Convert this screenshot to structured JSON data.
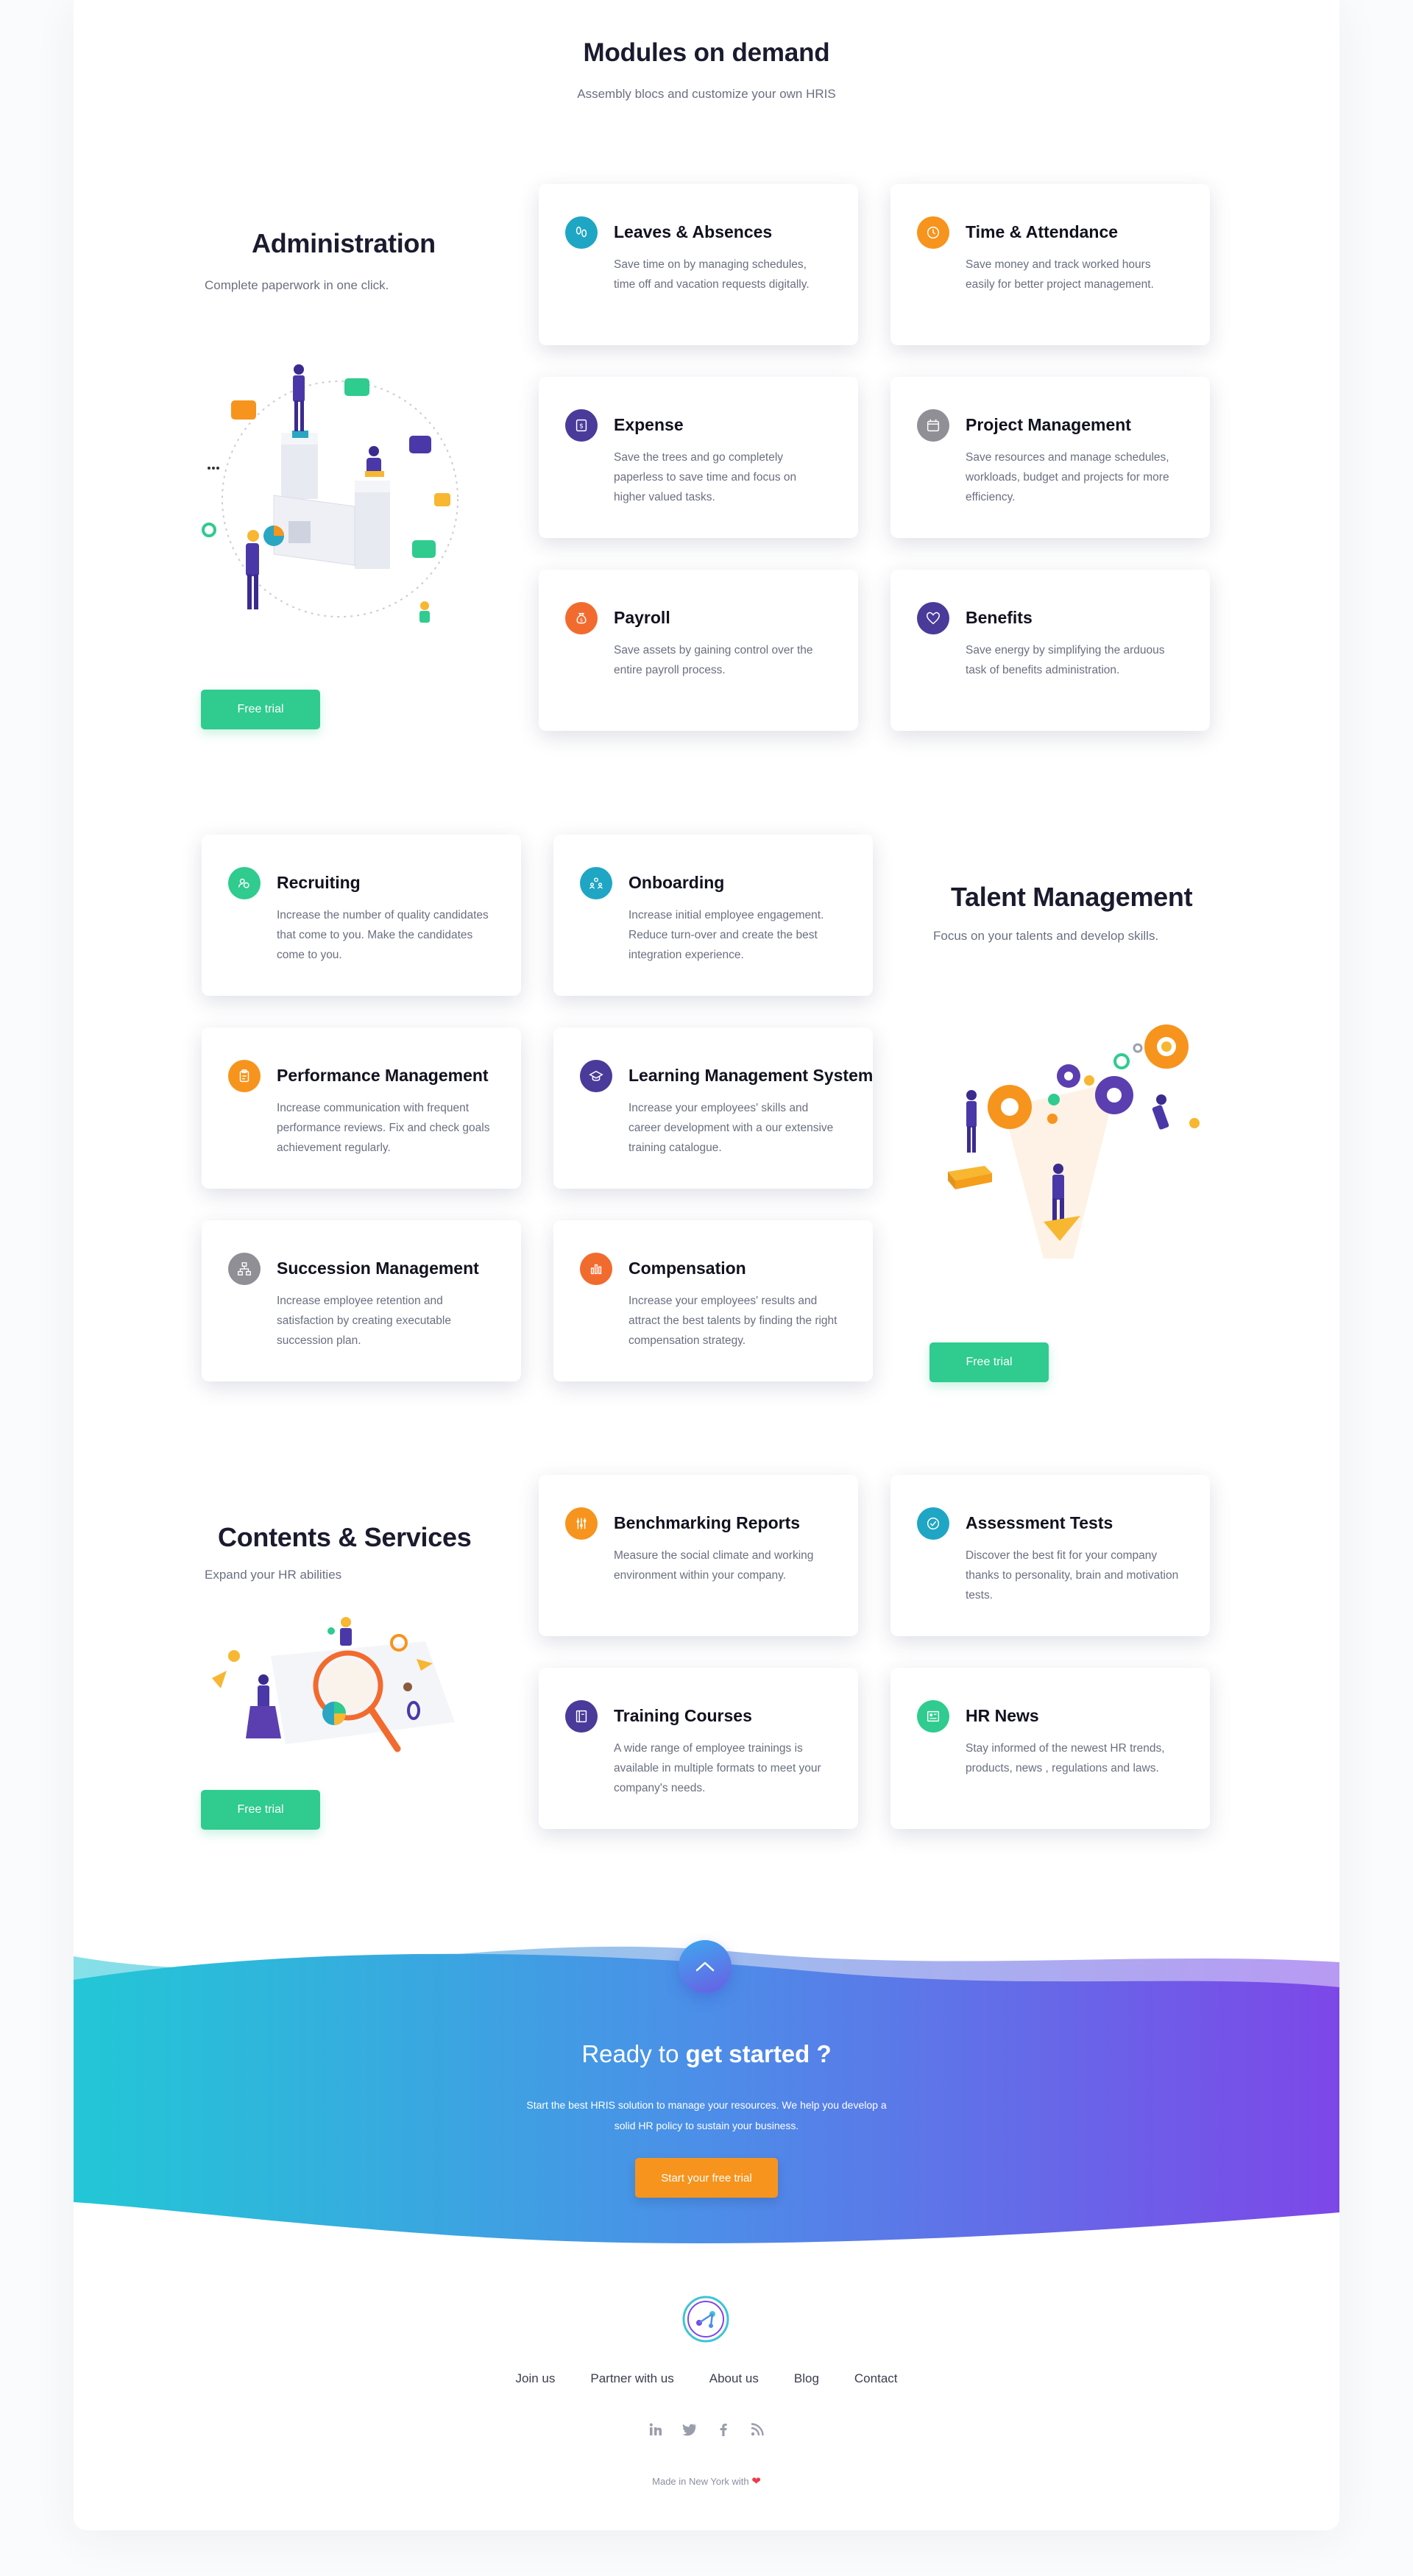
{
  "header": {
    "title": "Modules on demand",
    "subtitle": "Assembly blocs and customize your own HRIS"
  },
  "administration": {
    "title": "Administration",
    "subtitle": "Complete paperwork in one click.",
    "cta": "Free trial",
    "cards": [
      {
        "title": "Leaves & Absences",
        "text": "Save time on by managing schedules, time off and vacation requests digitally.",
        "icon": "footsteps-icon",
        "color": "#1fa6c4"
      },
      {
        "title": "Time & Attendance",
        "text": "Save money and track worked hours easily for better project management.",
        "icon": "clock-icon",
        "color": "#f7941d"
      },
      {
        "title": "Expense",
        "text": "Save the trees and go completely paperless to save time and focus on higher valued tasks.",
        "icon": "dollar-icon",
        "color": "#4a3a9a"
      },
      {
        "title": "Project Management",
        "text": "Save resources and manage schedules, workloads, budget and projects for more efficiency.",
        "icon": "calendar-icon",
        "color": "#8f8f95"
      },
      {
        "title": "Payroll",
        "text": "Save assets by gaining control over the entire payroll process.",
        "icon": "money-bag-icon",
        "color": "#f26b2e"
      },
      {
        "title": "Benefits",
        "text": "Save energy by simplifying the arduous task of benefits administration.",
        "icon": "heart-icon",
        "color": "#4a3a9a"
      }
    ]
  },
  "talent": {
    "title": "Talent Management",
    "subtitle": "Focus on your talents and develop skills.",
    "cta": "Free trial",
    "cards": [
      {
        "title": "Recruiting",
        "text": "Increase the number of quality candidates that come to you. Make the candidates come to you.",
        "icon": "people-search-icon",
        "color": "#2fcb8f"
      },
      {
        "title": "Onboarding",
        "text": "Increase initial employee engagement. Reduce turn-over and create the best integration experience.",
        "icon": "team-icon",
        "color": "#1fa6c4"
      },
      {
        "title": "Performance Management",
        "text": "Increase communication with frequent performance reviews. Fix and check goals achievement regularly.",
        "icon": "clipboard-icon",
        "color": "#f7941d"
      },
      {
        "title": "Learning Management System",
        "text": "Increase your employees' skills and career development with a our extensive training catalogue.",
        "icon": "graduation-cap-icon",
        "color": "#4a3a9a"
      },
      {
        "title": "Succession Management",
        "text": "Increase employee retention and satisfaction by creating executable succession plan.",
        "icon": "org-chart-icon",
        "color": "#8f8f95"
      },
      {
        "title": "Compensation",
        "text": "Increase your employees' results and attract the best talents by finding the right compensation strategy.",
        "icon": "bar-chart-icon",
        "color": "#f26b2e"
      }
    ]
  },
  "contents": {
    "title": "Contents & Services",
    "subtitle": "Expand your HR abilities",
    "cta": "Free trial",
    "cards": [
      {
        "title": "Benchmarking Reports",
        "text": "Measure the social climate and working environment within your company.",
        "icon": "sliders-icon",
        "color": "#f7941d"
      },
      {
        "title": "Assessment Tests",
        "text": "Discover the best fit for your company thanks to personality, brain and motivation tests.",
        "icon": "check-circle-icon",
        "color": "#1fa6c4"
      },
      {
        "title": "Training Courses",
        "text": "A wide range of employee trainings is available in multiple formats to meet your company's needs.",
        "icon": "book-icon",
        "color": "#4a3a9a"
      },
      {
        "title": "HR News",
        "text": "Stay informed of the newest HR trends, products, news , regulations and laws.",
        "icon": "newspaper-icon",
        "color": "#2fcb8f"
      }
    ]
  },
  "cta": {
    "title_prefix": "Ready to",
    "title_bold": "get started ?",
    "text": "Start the best HRIS solution to manage your resources. We help you develop a solid HR policy to sustain your business.",
    "button": "Start your free trial"
  },
  "footer": {
    "nav": [
      "Join us",
      "Partner with us",
      "About us",
      "Blog",
      "Contact"
    ],
    "social": [
      "linkedin-icon",
      "twitter-icon",
      "facebook-icon",
      "rss-icon"
    ],
    "made_in": "Made in New York with"
  }
}
